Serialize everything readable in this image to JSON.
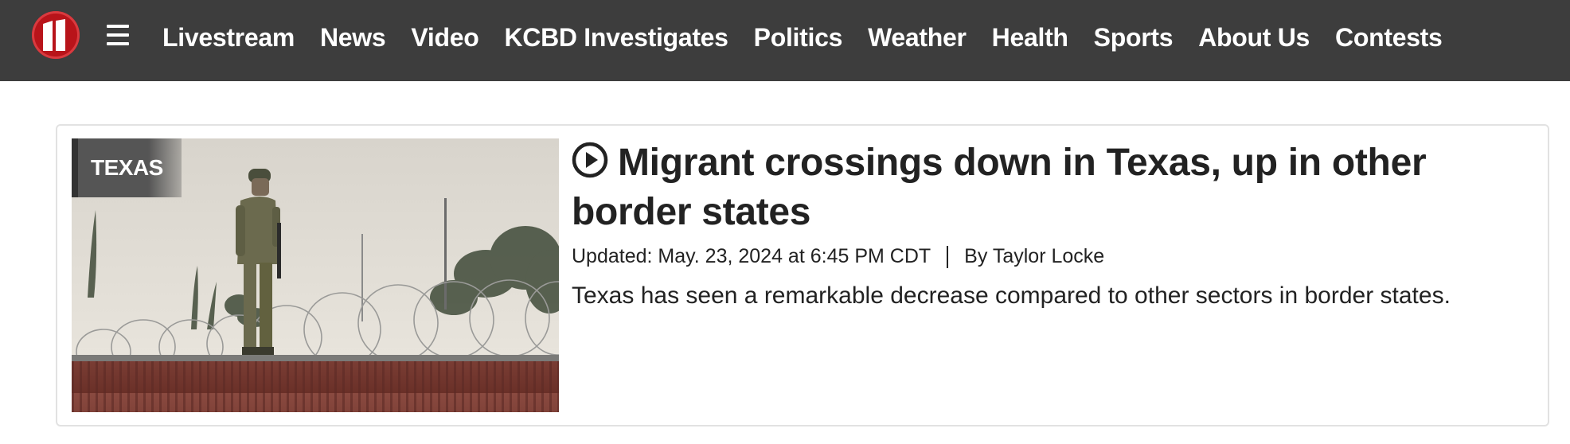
{
  "header": {
    "logo_icon": "kcbd-11-logo-icon",
    "menu_icon": "hamburger-menu-icon",
    "nav": [
      {
        "label": "Livestream"
      },
      {
        "label": "News"
      },
      {
        "label": "Video"
      },
      {
        "label": "KCBD Investigates"
      },
      {
        "label": "Politics"
      },
      {
        "label": "Weather"
      },
      {
        "label": "Health"
      },
      {
        "label": "Sports"
      },
      {
        "label": "About Us"
      },
      {
        "label": "Contests"
      }
    ],
    "bg_color": "#3d3d3d",
    "logo_color": "#b8141a"
  },
  "article": {
    "tag": "TEXAS",
    "headline": "Migrant crossings down in Texas, up in other border states",
    "play_icon": "play-circle-icon",
    "updated": "Updated: May. 23, 2024 at 6:45 PM CDT",
    "byline": "By Taylor Locke",
    "summary": "Texas has seen a remarkable decrease compared to other sectors in border states."
  }
}
